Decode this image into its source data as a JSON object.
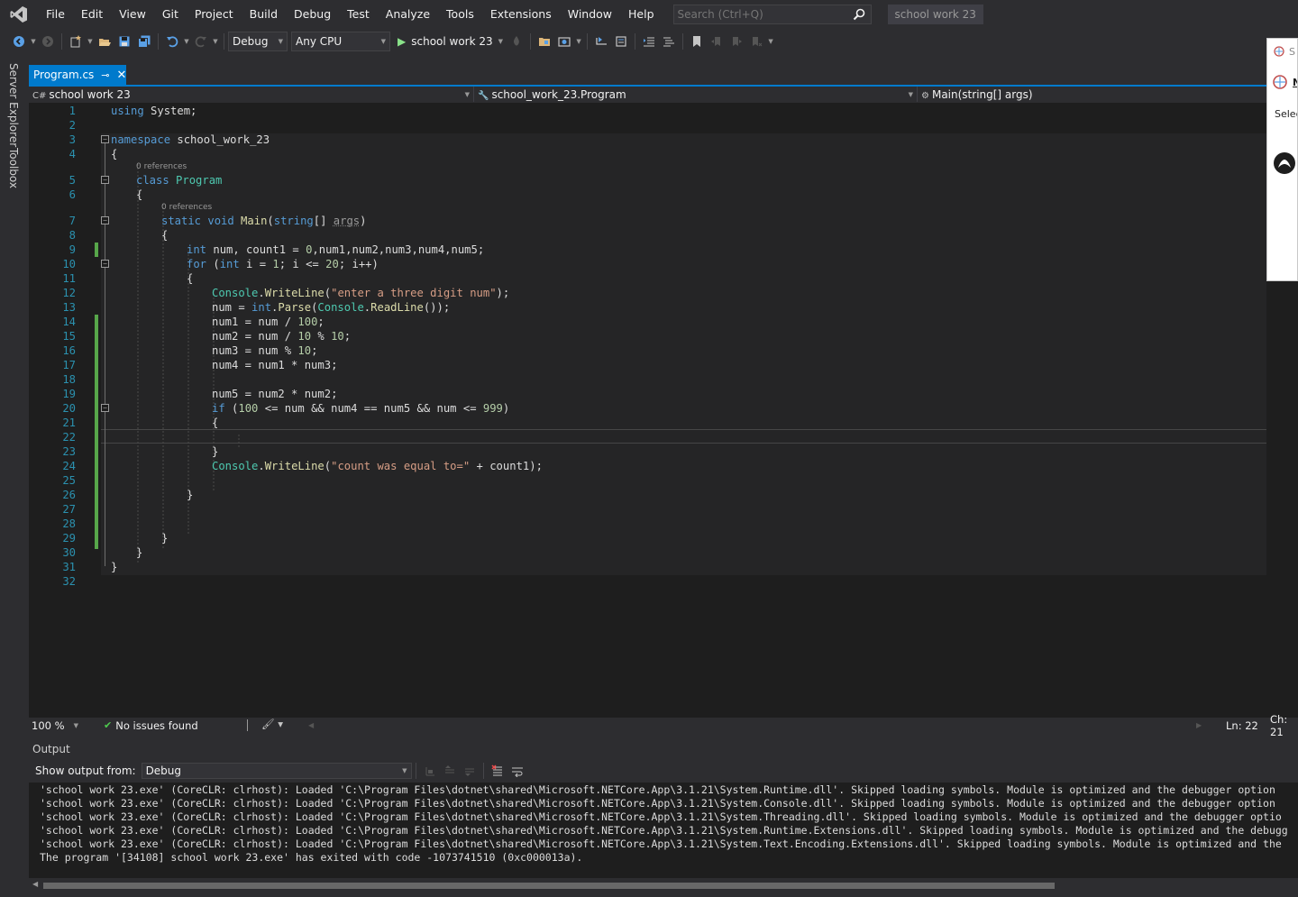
{
  "menubar": {
    "items": [
      "File",
      "Edit",
      "View",
      "Git",
      "Project",
      "Build",
      "Debug",
      "Test",
      "Analyze",
      "Tools",
      "Extensions",
      "Window",
      "Help"
    ],
    "search_placeholder": "Search (Ctrl+Q)",
    "solution_name": "school work 23"
  },
  "toolbar": {
    "configuration": "Debug",
    "platform": "Any CPU",
    "run_target": "school work 23"
  },
  "left_tabs": [
    "Server Explorer",
    "Toolbox"
  ],
  "document_tabs": [
    {
      "label": "Program.cs",
      "active": true
    }
  ],
  "navbar": {
    "project": "school work 23",
    "type": "school_work_23.Program",
    "member": "Main(string[] args)"
  },
  "editor": {
    "references_label": "0 references",
    "line_numbers": [
      "1",
      "2",
      "3",
      "4",
      "5",
      "6",
      "7",
      "8",
      "9",
      "10",
      "11",
      "12",
      "13",
      "14",
      "15",
      "16",
      "17",
      "18",
      "19",
      "20",
      "21",
      "22",
      "23",
      "24",
      "25",
      "26",
      "27",
      "28",
      "29",
      "30",
      "31",
      "32"
    ],
    "lines": {
      "l1_using": "using",
      "l1_ns": " System;",
      "l3_namespace": "namespace",
      "l3_name": " school_work_23",
      "l4": "{",
      "l5_class": "class",
      "l5_name": " Program",
      "l6": "{",
      "l7_static": "static",
      "l7_void": " void",
      "l7_main": " Main",
      "l7_open": "(",
      "l7_string": "string",
      "l7_arr": "[] ",
      "l7_args": "args",
      "l7_close": ")",
      "l8": "{",
      "l9_int": "int",
      "l9_a": " num, count1 = ",
      "l9_zero": "0",
      "l9_b": ",num1,num2,num3,num4,num5;",
      "l10_for": "for",
      "l10_a": " (",
      "l10_int": "int",
      "l10_b": " i = ",
      "l10_one": "1",
      "l10_c": "; i <= ",
      "l10_twenty": "20",
      "l10_d": "; i++)",
      "l11": "{",
      "l12_console": "Console",
      "l12_dot": ".",
      "l12_wl": "WriteLine",
      "l12_open": "(",
      "l12_str": "\"enter a three digit num\"",
      "l12_close": ");",
      "l13_a": "num = ",
      "l13_int": "int",
      "l13_dot": ".",
      "l13_parse": "Parse",
      "l13_open": "(",
      "l13_console": "Console",
      "l13_dot2": ".",
      "l13_rl": "ReadLine",
      "l13_close": "());",
      "l14_a": "num1 = num / ",
      "l14_n": "100",
      "l14_b": ";",
      "l15_a": "num2 = num / ",
      "l15_n1": "10",
      "l15_b": " % ",
      "l15_n2": "10",
      "l15_c": ";",
      "l16_a": "num3 = num % ",
      "l16_n": "10",
      "l16_b": ";",
      "l17": "num4 = num1 * num3;",
      "l19": "num5 = num2 * num2;",
      "l20_if": "if",
      "l20_a": " (",
      "l20_n1": "100",
      "l20_b": " <= num && num4 == num5 && num <= ",
      "l20_n2": "999",
      "l20_c": ")",
      "l21": "{",
      "l23": "}",
      "l24_console": "Console",
      "l24_dot": ".",
      "l24_wl": "WriteLine",
      "l24_open": "(",
      "l24_str": "\"count was equal to=\"",
      "l24_rest": " + count1);",
      "l26": "}",
      "l29": "}",
      "l30": "}",
      "l31": "}"
    }
  },
  "status": {
    "zoom": "100 %",
    "issues": "No issues found",
    "line": "Ln: 22",
    "col": "Ch: 21"
  },
  "output": {
    "title": "Output",
    "show_from_label": "Show output from:",
    "source": "Debug",
    "lines": [
      "'school work 23.exe' (CoreCLR: clrhost): Loaded 'C:\\Program Files\\dotnet\\shared\\Microsoft.NETCore.App\\3.1.21\\System.Runtime.dll'. Skipped loading symbols. Module is optimized and the debugger option",
      "'school work 23.exe' (CoreCLR: clrhost): Loaded 'C:\\Program Files\\dotnet\\shared\\Microsoft.NETCore.App\\3.1.21\\System.Console.dll'. Skipped loading symbols. Module is optimized and the debugger option",
      "'school work 23.exe' (CoreCLR: clrhost): Loaded 'C:\\Program Files\\dotnet\\shared\\Microsoft.NETCore.App\\3.1.21\\System.Threading.dll'. Skipped loading symbols. Module is optimized and the debugger optio",
      "'school work 23.exe' (CoreCLR: clrhost): Loaded 'C:\\Program Files\\dotnet\\shared\\Microsoft.NETCore.App\\3.1.21\\System.Runtime.Extensions.dll'. Skipped loading symbols. Module is optimized and the debugg",
      "'school work 23.exe' (CoreCLR: clrhost): Loaded 'C:\\Program Files\\dotnet\\shared\\Microsoft.NETCore.App\\3.1.21\\System.Text.Encoding.Extensions.dll'. Skipped loading symbols. Module is optimized and the",
      "The program '[34108] school work 23.exe' has exited with code -1073741510 (0xc000013a)."
    ]
  },
  "flyout": {
    "row1": "S",
    "row2": "N",
    "row3": "Selec butto"
  },
  "colors": {
    "accent": "#007acc",
    "background": "#2d2d30",
    "editor_bg": "#1e1e1e",
    "keyword": "#569cd6",
    "type": "#4ec9b0",
    "string": "#d69d85",
    "number": "#b5cea8",
    "method": "#dcdcaa",
    "line_number": "#2b91af",
    "change_bar": "#57a64a"
  }
}
